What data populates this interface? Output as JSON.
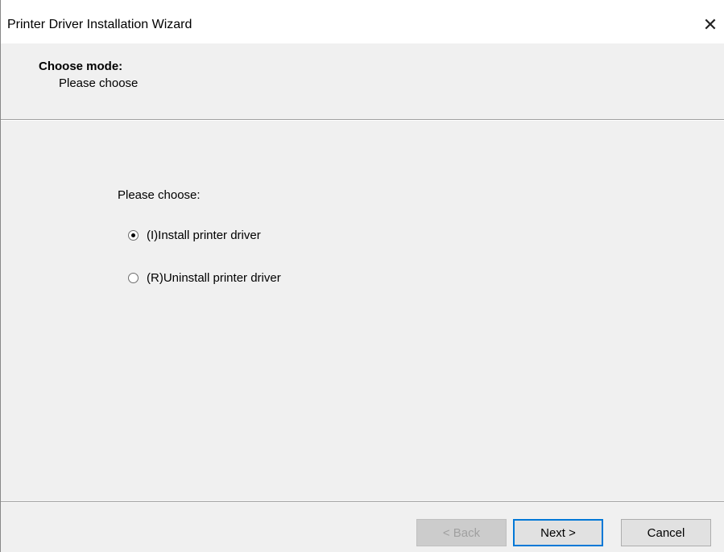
{
  "window": {
    "title": "Printer Driver Installation Wizard",
    "close_glyph": "✕"
  },
  "header": {
    "title": "Choose mode:",
    "subtitle": "Please choose"
  },
  "content": {
    "prompt": "Please choose:",
    "options": [
      {
        "label": "(I)Install printer driver",
        "selected": true
      },
      {
        "label": "(R)Uninstall printer driver",
        "selected": false
      }
    ]
  },
  "buttons": {
    "back": "< Back",
    "next": "Next >",
    "cancel": "Cancel"
  },
  "icons": {
    "close": "close-icon",
    "radio": "radio-icon"
  }
}
